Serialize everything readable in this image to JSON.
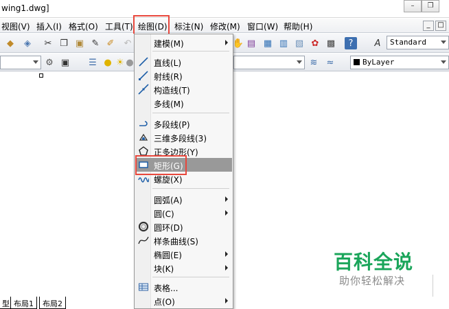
{
  "window": {
    "title": "wing1.dwg]",
    "min_glyph": "–",
    "restore_glyph": "❐"
  },
  "menubar": {
    "items": [
      "视图(V)",
      "插入(I)",
      "格式(O)",
      "工具(T)",
      "绘图(D)",
      "标注(N)",
      "修改(M)",
      "窗口(W)",
      "帮助(H)"
    ],
    "mdi_min": "_",
    "mdi_restore": "□"
  },
  "toolbar": {
    "text_style": "Standard",
    "linetype": "ByLayer"
  },
  "draw_menu": {
    "items": [
      {
        "label": "建模(M)",
        "icon": "none",
        "submenu": true
      },
      {
        "label": "直线(L)",
        "icon": "line-icon"
      },
      {
        "label": "射线(R)",
        "icon": "ray-icon"
      },
      {
        "label": "构造线(T)",
        "icon": "xline-icon"
      },
      {
        "label": "多线(M)",
        "icon": "none"
      },
      {
        "label": "多段线(P)",
        "icon": "polyline-icon"
      },
      {
        "label": "三维多段线(3)",
        "icon": "3d-polyline-icon"
      },
      {
        "label": "正多边形(Y)",
        "icon": "polygon-icon"
      },
      {
        "label": "矩形(G)",
        "icon": "rectangle-icon",
        "highlight": true
      },
      {
        "label": "螺旋(X)",
        "icon": "helix-icon"
      },
      {
        "label": "圆弧(A)",
        "icon": "none",
        "submenu": true
      },
      {
        "label": "圆(C)",
        "icon": "none",
        "submenu": true
      },
      {
        "label": "圆环(D)",
        "icon": "donut-icon"
      },
      {
        "label": "样条曲线(S)",
        "icon": "spline-icon"
      },
      {
        "label": "椭圆(E)",
        "icon": "none",
        "submenu": true
      },
      {
        "label": "块(K)",
        "icon": "none",
        "submenu": true
      },
      {
        "label": "表格...",
        "icon": "table-icon"
      },
      {
        "label": "点(O)",
        "icon": "none",
        "submenu": true
      }
    ]
  },
  "layout_tabs": [
    "型",
    "布局1",
    "布局2"
  ],
  "watermark": {
    "title": "百科全说",
    "subtitle": "助你轻松解决"
  },
  "colors": {
    "highlight_box": "#e8473c",
    "watermark_green": "#1aa55a",
    "menu_highlight": "#999999"
  }
}
